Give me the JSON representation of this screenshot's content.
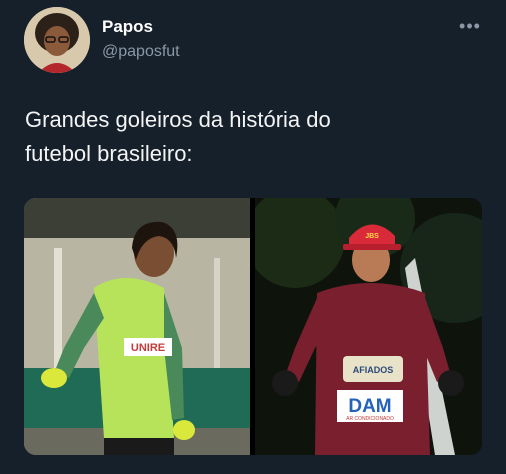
{
  "author": {
    "name": "Papos",
    "handle": "@paposfut"
  },
  "more_icon": "more-horizontal-icon",
  "tweet": {
    "text_line1": "Grandes goleiros da história do",
    "text_line2": "futebol brasileiro:"
  },
  "photos": {
    "left": {
      "jersey_label": "UNIRE"
    },
    "right": {
      "cap_label": "JBS",
      "sponsor_label": "AFIADOS",
      "sponsor2_label": "DAM",
      "sponsor2_sub": "AR CONDICIONADO"
    }
  }
}
